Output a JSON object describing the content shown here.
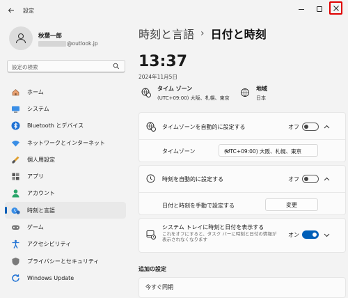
{
  "window": {
    "title": "設定"
  },
  "user": {
    "name": "秋葉一郎",
    "email_suffix": "@outlook.jp"
  },
  "search": {
    "placeholder": "設定の検索"
  },
  "sidebar": {
    "items": [
      {
        "label": "ホーム",
        "icon": "home-icon",
        "active": false
      },
      {
        "label": "システム",
        "icon": "monitor-icon",
        "active": false
      },
      {
        "label": "Bluetooth とデバイス",
        "icon": "bluetooth-icon",
        "active": false
      },
      {
        "label": "ネットワークとインターネット",
        "icon": "wifi-icon",
        "active": false
      },
      {
        "label": "個人用設定",
        "icon": "brush-icon",
        "active": false
      },
      {
        "label": "アプリ",
        "icon": "apps-icon",
        "active": false
      },
      {
        "label": "アカウント",
        "icon": "person-icon",
        "active": false
      },
      {
        "label": "時刻と言語",
        "icon": "time-language-icon",
        "active": true
      },
      {
        "label": "ゲーム",
        "icon": "gamepad-icon",
        "active": false
      },
      {
        "label": "アクセシビリティ",
        "icon": "accessibility-icon",
        "active": false
      },
      {
        "label": "プライバシーとセキュリティ",
        "icon": "shield-icon",
        "active": false
      },
      {
        "label": "Windows Update",
        "icon": "update-icon",
        "active": false
      }
    ]
  },
  "breadcrumb": {
    "parent": "時刻と言語",
    "separator": "›",
    "current": "日付と時刻"
  },
  "clock": {
    "time": "13:37",
    "date": "2024年11月5日"
  },
  "timezone_block": {
    "title": "タイム ゾーン",
    "value": "(UTC+09:00) 大阪、札幌、東京"
  },
  "region_block": {
    "title": "地域",
    "value": "日本"
  },
  "auto_timezone": {
    "label": "タイムゾーンを自動的に設定する",
    "state": "オフ",
    "on": false
  },
  "timezone_row": {
    "label": "タイムゾーン",
    "selected": "(UTC+09:00) 大阪、札幌、東京"
  },
  "auto_time": {
    "label": "時刻を自動的に設定する",
    "state": "オフ",
    "on": false
  },
  "manual_row": {
    "label": "日付と時刻を手動で設定する",
    "button": "変更"
  },
  "tray": {
    "label": "システム トレイに時刻と日付を表示する",
    "description": "これをオフにすると、タスク バーに時刻と日付の情報が表示されなくなります",
    "state": "オン",
    "on": true
  },
  "additional": {
    "title": "追加の設定",
    "sync_label": "今すぐ同期"
  },
  "colors": {
    "accent": "#005fb8",
    "close_highlight": "#e00000"
  }
}
